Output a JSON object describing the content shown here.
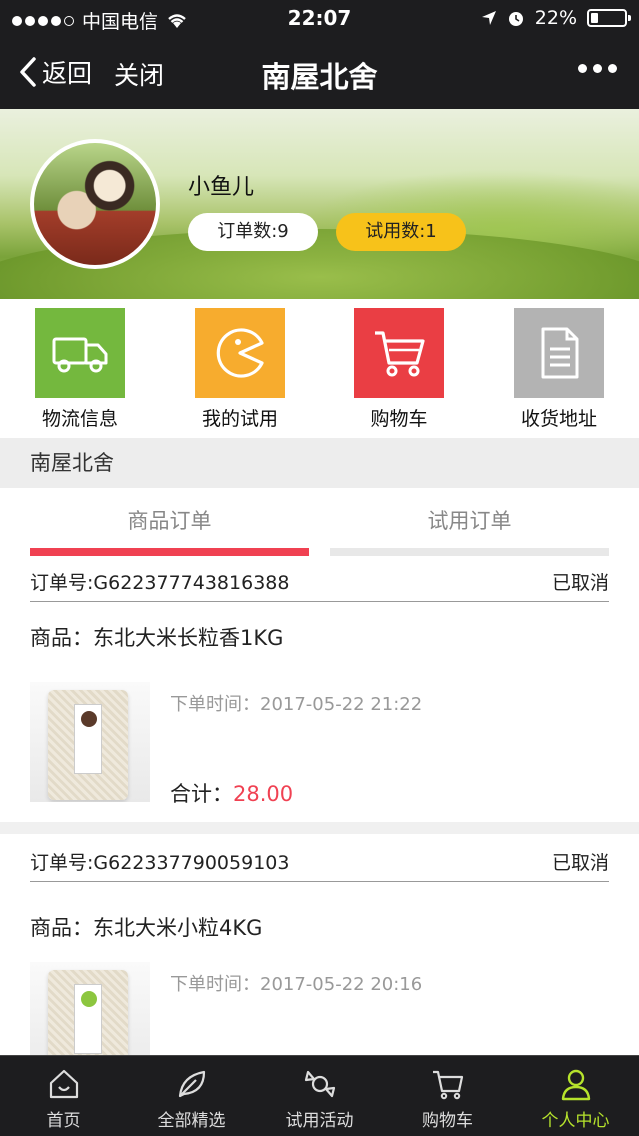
{
  "status_bar": {
    "carrier": "中国电信",
    "time": "22:07",
    "battery": "22%",
    "battery_level": 0.22
  },
  "nav": {
    "back_label": "返回",
    "close_label": "关闭",
    "title": "南屋北舍"
  },
  "profile": {
    "username": "小鱼儿",
    "orders_badge": "订单数:9",
    "trials_badge": "试用数:1"
  },
  "quick_menu": [
    {
      "label": "物流信息",
      "icon": "truck-icon",
      "color": "#74b83e"
    },
    {
      "label": "我的试用",
      "icon": "pacman-icon",
      "color": "#f7ac2e"
    },
    {
      "label": "购物车",
      "icon": "cart-icon",
      "color": "#ea3e44"
    },
    {
      "label": "收货地址",
      "icon": "document-icon",
      "color": "#b3b3b3"
    }
  ],
  "section_header": "南屋北舍",
  "tabs": [
    {
      "label": "商品订单",
      "active": true
    },
    {
      "label": "试用订单",
      "active": false
    }
  ],
  "orders": [
    {
      "id_label": "订单号:",
      "id": "G622377743816388",
      "status": "已取消",
      "product": "商品：东北大米长粒香1KG",
      "time_label": "下单时间：",
      "time": "2017-05-22 21:22",
      "total_label": "合计：",
      "total": "28.00"
    },
    {
      "id_label": "订单号:",
      "id": "G622337790059103",
      "status": "已取消",
      "product": "商品：东北大米小粒4KG",
      "time_label": "下单时间：",
      "time": "2017-05-22 20:16"
    }
  ],
  "bottom_nav": [
    {
      "label": "首页",
      "icon": "home-icon",
      "active": false
    },
    {
      "label": "全部精选",
      "icon": "leaf-icon",
      "active": false
    },
    {
      "label": "试用活动",
      "icon": "candy-icon",
      "active": false
    },
    {
      "label": "购物车",
      "icon": "cart-icon",
      "active": false
    },
    {
      "label": "个人中心",
      "icon": "user-icon",
      "active": true
    }
  ],
  "colors": {
    "accent_red": "#f04152",
    "active_green": "#b6e32c",
    "badge_yellow": "#f7c21a",
    "bar_dark": "#1d1d1f"
  }
}
